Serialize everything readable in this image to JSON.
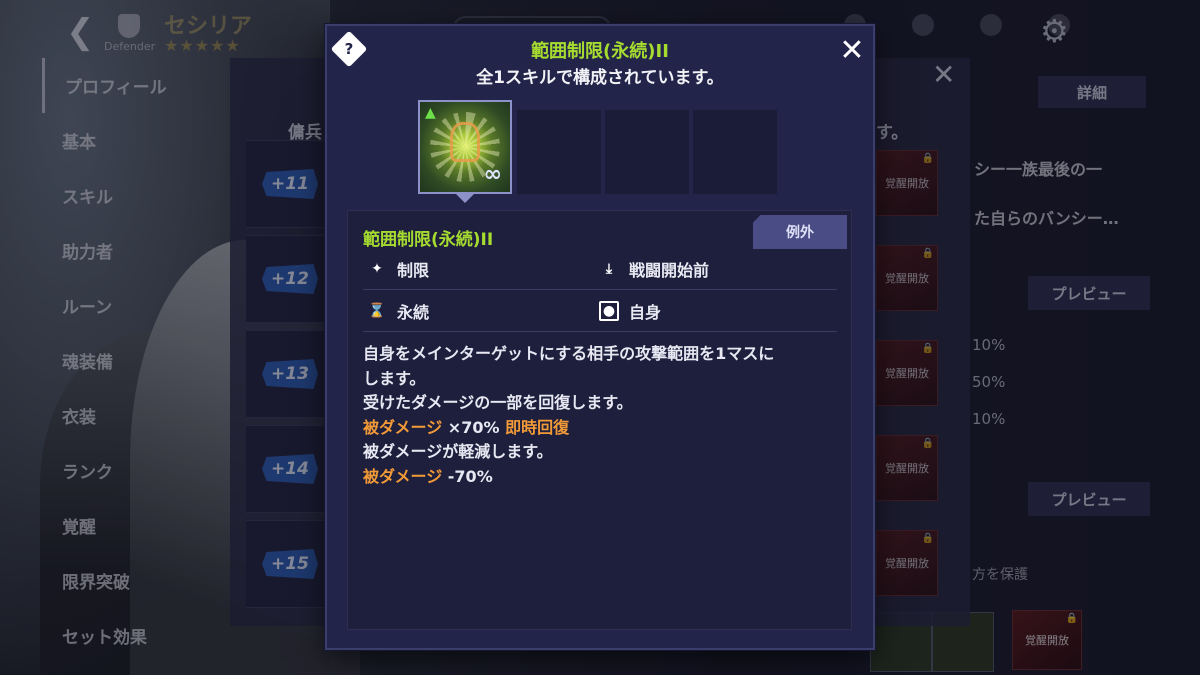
{
  "header": {
    "back_icon": "back-chevron-icon",
    "role": "Defender",
    "hero_name": "セシリア",
    "stars": "★★★★★"
  },
  "side_menu": {
    "items": [
      {
        "label": "プロフィール",
        "active": true
      },
      {
        "label": "基本"
      },
      {
        "label": "スキル"
      },
      {
        "label": "助力者"
      },
      {
        "label": "ルーン"
      },
      {
        "label": "魂装備"
      },
      {
        "label": "衣装"
      },
      {
        "label": "ランク"
      },
      {
        "label": "覚醒"
      },
      {
        "label": "限界突破"
      },
      {
        "label": "セット効果"
      }
    ]
  },
  "back_panel": {
    "title_left": "傭兵",
    "title_right": "す。",
    "levels": [
      "+11",
      "+12",
      "+13",
      "+14",
      "+15"
    ],
    "awaken_label": "覚醒開放",
    "detail_tab": "詳細",
    "lore_line1": "シー一族最後の一",
    "lore_line2": "た自らのバンシー…",
    "preview_label": "プレビュー",
    "stats": [
      "10%",
      "50%",
      "10%"
    ],
    "protect_text": "方を保護"
  },
  "popup": {
    "title": "範囲制限(永続)II",
    "subtitle": "全1スキルで構成されています。",
    "help_symbol": "?",
    "close_symbol": "✕",
    "exception_tab": "例外",
    "skill_name": "範囲制限(永続)II",
    "attributes": {
      "type": "制限",
      "timing": "戦闘開始前",
      "duration": "永続",
      "target": "自身"
    },
    "description": {
      "line1": "自身をメインターゲットにする相手の攻撃範囲を1マスに",
      "line2": "します。",
      "line3": "受けたダメージの一部を回復します。",
      "line4_highlight": "被ダメージ",
      "line4_value": "×70%",
      "line4_tag": "即時回復",
      "line5": "被ダメージが軽減します。",
      "line6_highlight": "被ダメージ",
      "line6_value": "-70%"
    }
  },
  "colors": {
    "accent_green": "#a6dc30",
    "highlight_orange": "#f29a38",
    "popup_bg": "#23244a",
    "level_badge": "#2e5fb6"
  }
}
